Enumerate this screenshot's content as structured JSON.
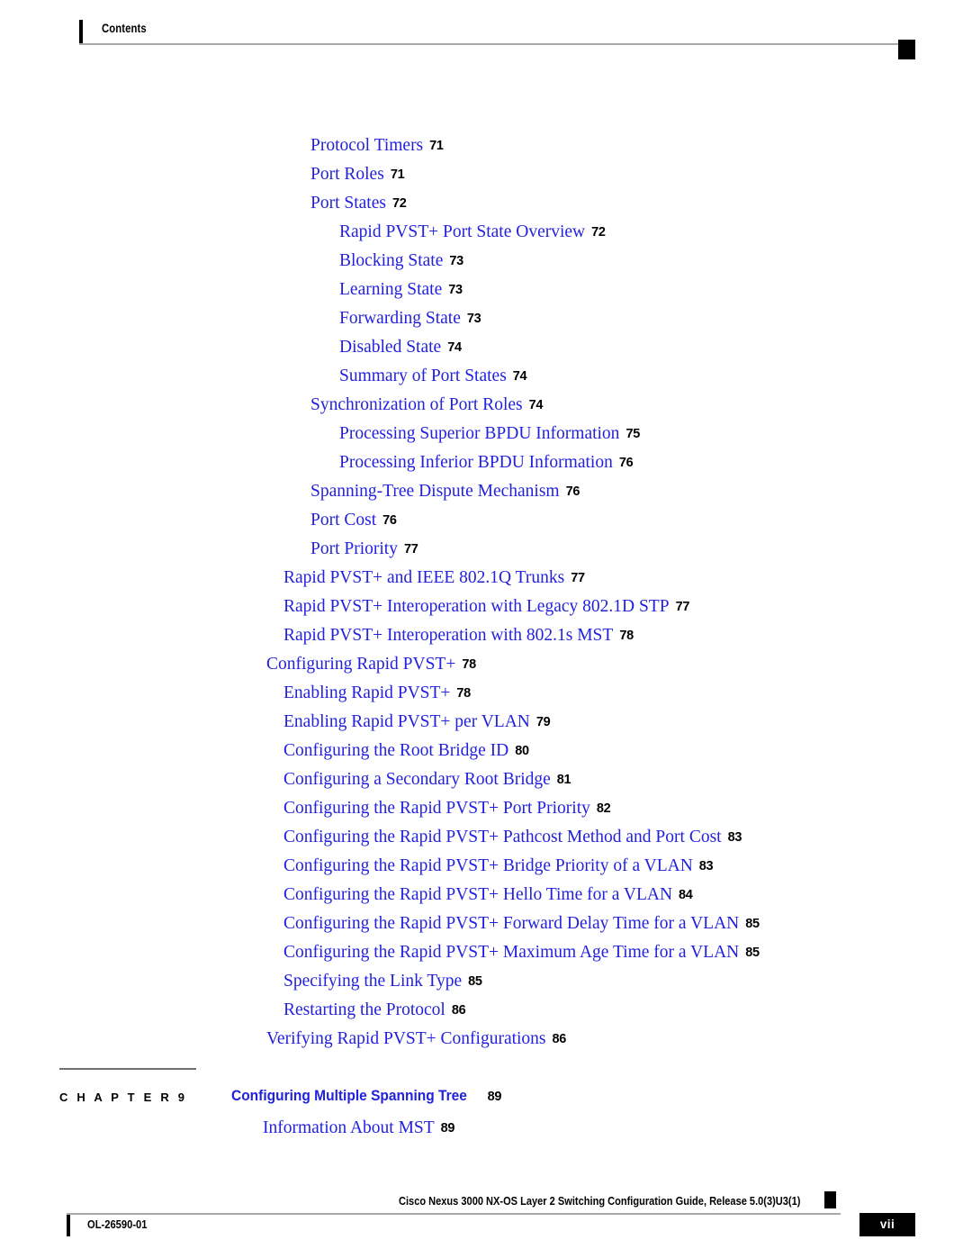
{
  "header": {
    "label": "Contents"
  },
  "toc": {
    "entries": [
      {
        "title": "Protocol Timers",
        "page": "71",
        "level": 2
      },
      {
        "title": "Port Roles",
        "page": "71",
        "level": 2
      },
      {
        "title": "Port States",
        "page": "72",
        "level": 2
      },
      {
        "title": "Rapid PVST+ Port State Overview",
        "page": "72",
        "level": 3
      },
      {
        "title": "Blocking State",
        "page": "73",
        "level": 3
      },
      {
        "title": "Learning State",
        "page": "73",
        "level": 3
      },
      {
        "title": "Forwarding State",
        "page": "73",
        "level": 3
      },
      {
        "title": "Disabled State",
        "page": "74",
        "level": 3
      },
      {
        "title": "Summary of Port States",
        "page": "74",
        "level": 3
      },
      {
        "title": "Synchronization of Port Roles",
        "page": "74",
        "level": 2
      },
      {
        "title": "Processing Superior BPDU Information",
        "page": "75",
        "level": 3
      },
      {
        "title": "Processing Inferior BPDU Information",
        "page": "76",
        "level": 3
      },
      {
        "title": "Spanning-Tree Dispute Mechanism",
        "page": "76",
        "level": 2
      },
      {
        "title": "Port Cost",
        "page": "76",
        "level": 2
      },
      {
        "title": "Port Priority",
        "page": "77",
        "level": 2
      },
      {
        "title": "Rapid PVST+ and IEEE 802.1Q Trunks",
        "page": "77",
        "level": 1
      },
      {
        "title": "Rapid PVST+ Interoperation with Legacy 802.1D STP",
        "page": "77",
        "level": 1
      },
      {
        "title": "Rapid PVST+ Interoperation with 802.1s MST",
        "page": "78",
        "level": 1
      },
      {
        "title": "Configuring Rapid PVST+",
        "page": "78",
        "level": 0
      },
      {
        "title": "Enabling Rapid PVST+",
        "page": "78",
        "level": 1
      },
      {
        "title": "Enabling Rapid PVST+ per VLAN",
        "page": "79",
        "level": 1
      },
      {
        "title": "Configuring the Root Bridge ID",
        "page": "80",
        "level": 1
      },
      {
        "title": "Configuring a Secondary Root Bridge",
        "page": "81",
        "level": 1
      },
      {
        "title": "Configuring the Rapid PVST+ Port Priority",
        "page": "82",
        "level": 1
      },
      {
        "title": "Configuring the Rapid PVST+ Pathcost Method and Port Cost",
        "page": "83",
        "level": 1
      },
      {
        "title": "Configuring the Rapid PVST+ Bridge Priority of a VLAN",
        "page": "83",
        "level": 1
      },
      {
        "title": "Configuring the Rapid PVST+ Hello Time for a VLAN",
        "page": "84",
        "level": 1
      },
      {
        "title": "Configuring the Rapid PVST+ Forward Delay Time for a VLAN",
        "page": "85",
        "level": 1
      },
      {
        "title": "Configuring the Rapid PVST+ Maximum Age Time for a VLAN",
        "page": "85",
        "level": 1
      },
      {
        "title": "Specifying the Link Type",
        "page": "85",
        "level": 1
      },
      {
        "title": "Restarting the Protocol",
        "page": "86",
        "level": 1
      },
      {
        "title": "Verifying Rapid PVST+ Configurations",
        "page": "86",
        "level": 0
      }
    ]
  },
  "chapter": {
    "label": "C H A P T E R  9",
    "title": "Configuring Multiple Spanning Tree",
    "page": "89",
    "sub_title": "Information About MST",
    "sub_page": "89"
  },
  "footer": {
    "guide": "Cisco Nexus 3000 NX-OS Layer 2 Switching Configuration Guide, Release 5.0(3)U3(1)",
    "doc_id": "OL-26590-01",
    "page_number": "vii"
  },
  "colors": {
    "link_blue": "#2222dd",
    "text_black": "#000000",
    "rule_gray": "#a8a8a8"
  }
}
